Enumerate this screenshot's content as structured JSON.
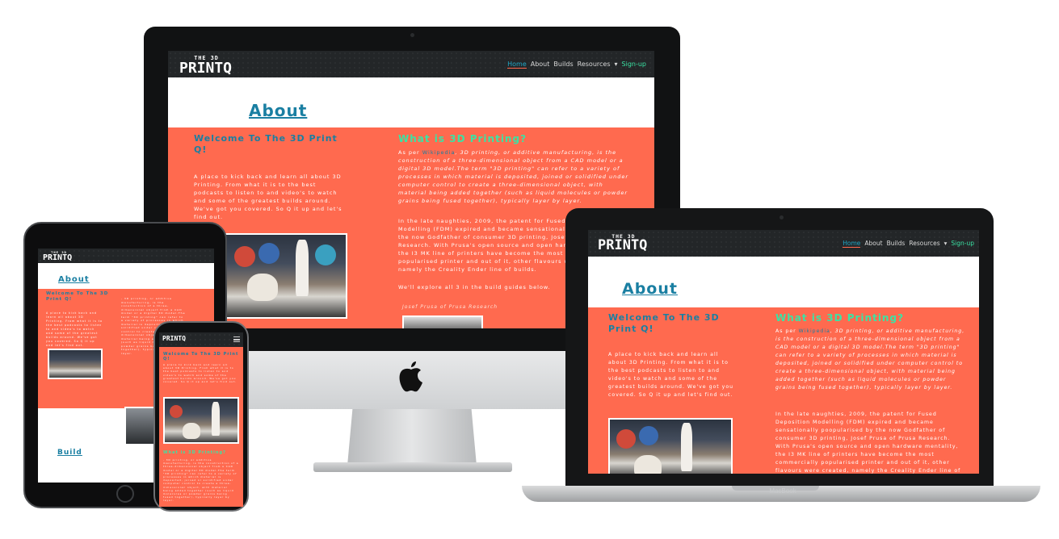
{
  "site": {
    "logo_small": "THE 3D",
    "logo_main": "PRINTQ",
    "nav": {
      "home": "Home",
      "about": "About",
      "builds": "Builds",
      "resources": "Resources",
      "caret": "▾",
      "signup": "Sign-up"
    },
    "about_heading": "About",
    "welcome_heading": "Welcome To The 3D Print Q!",
    "welcome_text": "A place to kick back and learn all about 3D Printing. From what it is to the best podcasts to listen to and video's to watch and some of the greatest builds around. We've got you covered. So Q it up and let's find out.",
    "what_heading": "What is 3D Printing?",
    "what_prefix": "As per ",
    "what_link": "Wikipedia",
    "what_quote": ", 3D printing, or additive manufacturing, is the construction of a three-dimensional object from a CAD model or a digital 3D model.The term \"3D printing\" can refer to a variety of processes in which material is deposited, joined or solidified under computer control to create a three-dimensional object, with material being added together (such as liquid molecules or powder grains being fused together), typically layer by layer.",
    "history_text": "In the late naughties, 2009, the patent for Fused Deposition Modelling (FDM) expired and became sensationally poopularised by the now Godfather of consumer 3D printing, Josef Prusa of Prusa Research. With Prusa's open source and open hardware mentality, the I3 MK line of printers have become the most commercially popularised printer and out of it, other flavours were created, namely the Creality Ender line of builds.",
    "explore_text": "We'll explore all 3 in the build guides below.",
    "photo_caption": "Josef Prusa of Prusa Research",
    "build_heading": "Build",
    "phone_what_heading": "What is 3D Printing?"
  },
  "devices": {
    "laptop_brand": "MacBook"
  },
  "colors": {
    "brand_coral": "#ff6a4f",
    "nav_dark": "#232628",
    "accent_teal": "#1a7fa2",
    "accent_green": "#3be3a4"
  }
}
